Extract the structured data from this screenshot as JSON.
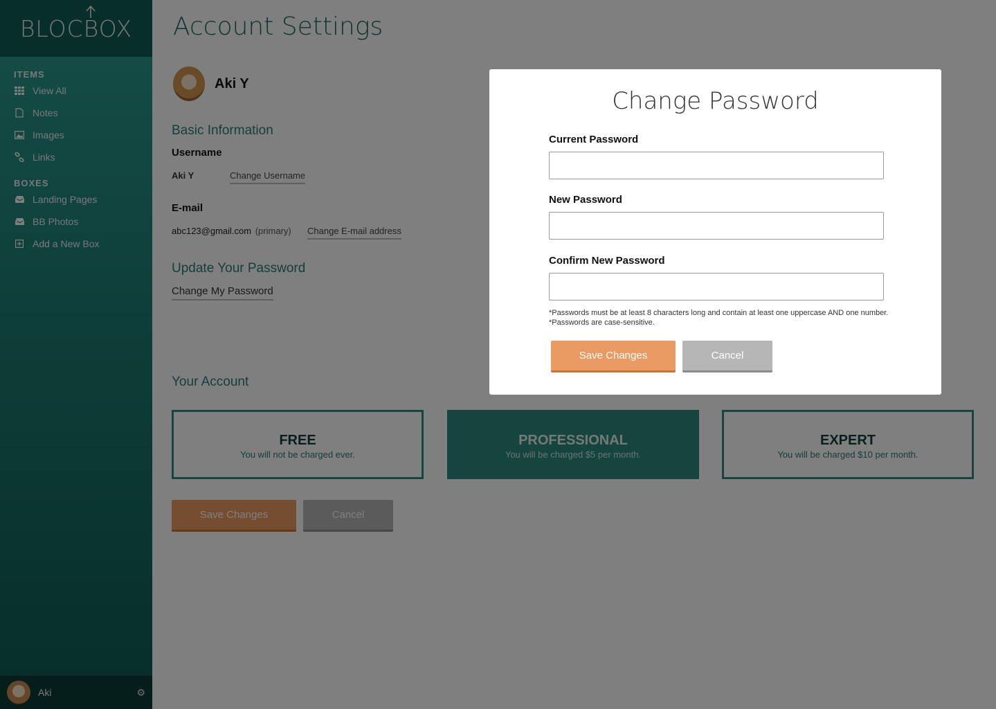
{
  "sidebar": {
    "logo": "BLOCBOX",
    "items_heading": "ITEMS",
    "items": [
      {
        "label": "View All",
        "icon": "grid-icon"
      },
      {
        "label": "Notes",
        "icon": "document-icon"
      },
      {
        "label": "Images",
        "icon": "image-icon"
      },
      {
        "label": "Links",
        "icon": "link-icon"
      }
    ],
    "boxes_heading": "BOXES",
    "boxes": [
      {
        "label": "Landing Pages",
        "icon": "inbox-icon"
      },
      {
        "label": "BB Photos",
        "icon": "inbox-icon"
      },
      {
        "label": "Add a New Box",
        "icon": "plus-square-icon"
      }
    ],
    "footer": {
      "name": "Aki"
    }
  },
  "main": {
    "title": "Account Settings",
    "profile_name": "Aki Y",
    "basic_info_heading": "Basic Information",
    "username_label": "Username",
    "username_value": "Aki Y",
    "change_username": "Change Username",
    "email_label": "E-mail",
    "email_value": "abc123@gmail.com",
    "email_primary": "(primary)",
    "change_email": "Change E-mail address",
    "password_heading": "Update Your Password",
    "change_password": "Change My Password",
    "account_heading": "Your Account",
    "plans": [
      {
        "name": "FREE",
        "desc": "You will not be charged ever."
      },
      {
        "name": "PROFESSIONAL",
        "desc": "You will be charged $5 per month."
      },
      {
        "name": "EXPERT",
        "desc": "You will be charged $10 per month."
      }
    ],
    "save_label": "Save Changes",
    "cancel_label": "Cancel"
  },
  "modal": {
    "title": "Change Password",
    "current_label": "Current Password",
    "new_label": "New Password",
    "confirm_label": "Confirm New Password",
    "current_value": "",
    "new_value": "",
    "confirm_value": "",
    "note_1": "*Passwords must be at least 8 characters long and contain at least one uppercase AND one number.",
    "note_2": "*Passwords are case-sensitive.",
    "save_label": "Save Changes",
    "cancel_label": "Cancel"
  },
  "colors": {
    "accent": "#2c8a80",
    "orange": "#ea9a63",
    "overlay": "rgba(0,0,0,0.5)"
  }
}
